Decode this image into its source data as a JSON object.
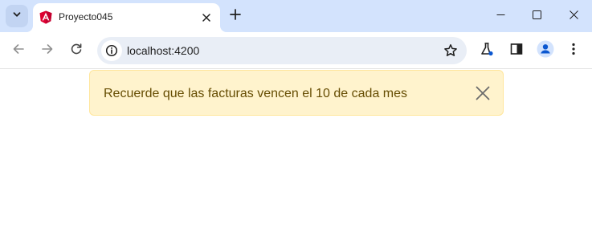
{
  "browser": {
    "tab_title": "Proyecto045",
    "url": "localhost:4200"
  },
  "alert": {
    "message": "Recuerde que las facturas vencen el 10 de cada mes"
  },
  "colors": {
    "titlebar": "#d3e3fd",
    "omnibox": "#e9eef6",
    "alert_bg": "#fff3cd",
    "alert_border": "#ffe69c",
    "alert_text": "#664d03",
    "angular_red": "#dd0031",
    "profile_blue": "#0b57d0"
  },
  "icons": {
    "tab_search": "chevron-down-icon",
    "favicon": "angular-logo-icon",
    "tab_close": "close-icon",
    "new_tab": "plus-icon",
    "minimize": "minimize-icon",
    "maximize": "maximize-icon",
    "close_window": "close-icon",
    "back": "arrow-left-icon",
    "forward": "arrow-right-icon",
    "reload": "reload-icon",
    "site_info": "info-icon",
    "bookmark": "star-icon",
    "labs": "flask-icon",
    "side_panel": "side-panel-icon",
    "profile": "profile-icon",
    "menu": "kebab-menu-icon",
    "alert_close": "close-icon"
  }
}
